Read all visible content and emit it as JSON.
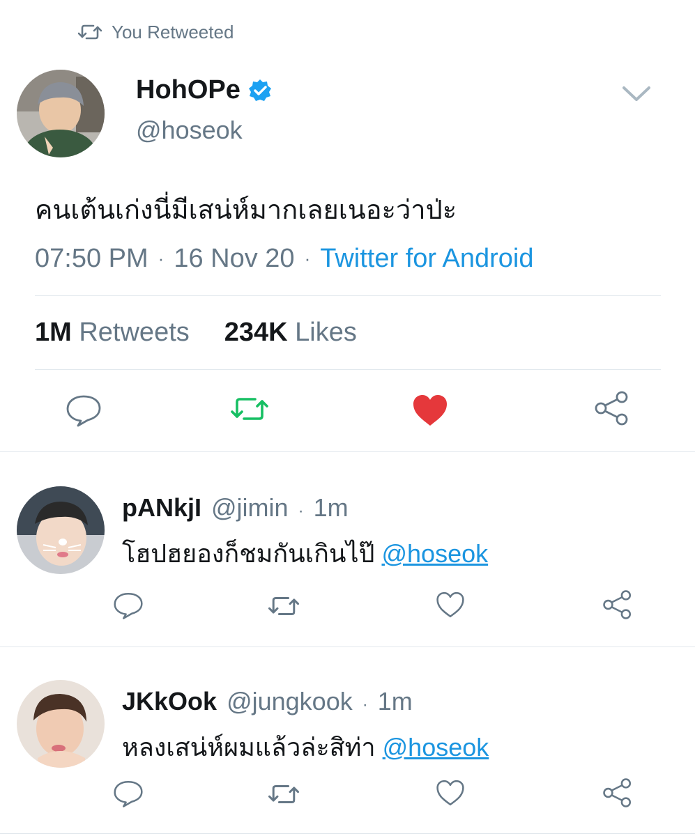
{
  "retweet_banner": {
    "text": "You Retweeted"
  },
  "main_tweet": {
    "display_name": "HohOPe",
    "handle": "@hoseok",
    "verified": true,
    "text": "คนเต้นเก่งนี่มีเสน่ห์มากเลยเนอะว่าป่ะ",
    "time": "07:50 PM",
    "date": "16 Nov 20",
    "source": "Twitter for Android",
    "retweets_count": "1M",
    "retweets_label": "Retweets",
    "likes_count": "234K",
    "likes_label": "Likes",
    "retweeted": true,
    "liked": true
  },
  "replies": [
    {
      "display_name": "pANkjI",
      "handle": "@jimin",
      "time": "1m",
      "text": "โฮปฮยองก็ชมกันเกินไป๊",
      "mention": "@hoseok"
    },
    {
      "display_name": "JKkOok",
      "handle": "@jungkook",
      "time": "1m",
      "text": "หลงเสน่ห์ผมแล้วล่ะสิท่า",
      "mention": "@hoseok"
    }
  ],
  "colors": {
    "text": "#14171a",
    "secondary": "#657786",
    "accent": "#1b95e0",
    "retweet_active": "#17bf63",
    "like_active": "#e0245e",
    "divider": "#e1e8ed"
  },
  "icons": [
    "retweet-icon",
    "verified-badge-icon",
    "chevron-down-icon",
    "reply-icon",
    "heart-icon",
    "share-icon"
  ]
}
